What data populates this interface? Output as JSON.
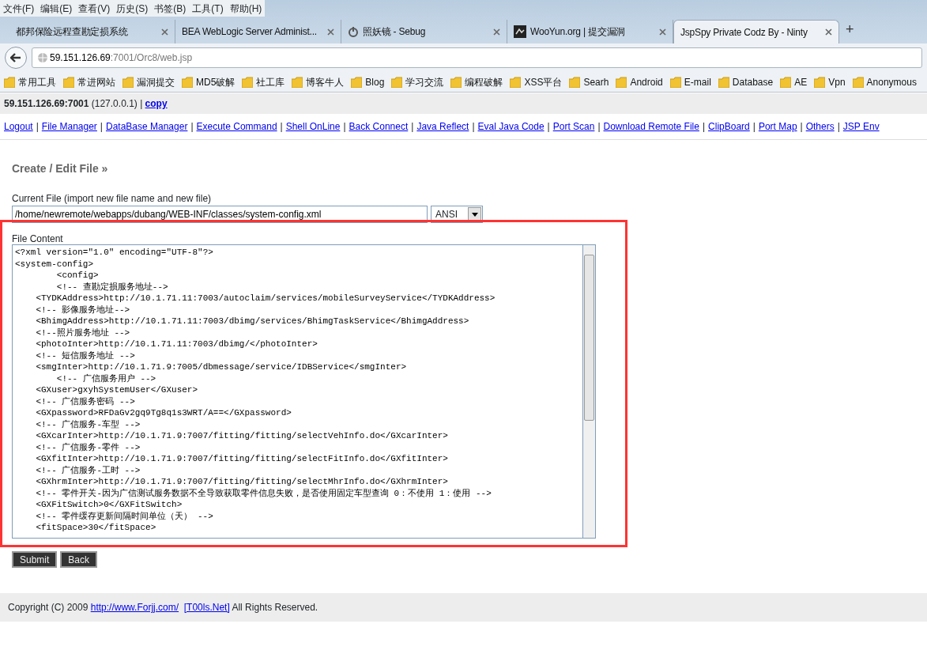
{
  "menu": [
    "文件(F)",
    "编辑(E)",
    "查看(V)",
    "历史(S)",
    "书签(B)",
    "工具(T)",
    "帮助(H)"
  ],
  "tabs": [
    {
      "label": "都邦保险远程查勘定损系统",
      "selected": false,
      "kind": "plain"
    },
    {
      "label": "BEA WebLogic Server Administ...",
      "selected": false,
      "kind": "plain"
    },
    {
      "label": "照妖镜 - Sebug",
      "selected": false,
      "kind": "ring"
    },
    {
      "label": "WooYun.org | 提交漏洞",
      "selected": false,
      "kind": "square"
    },
    {
      "label": "JspSpy Private Codz By - Ninty",
      "selected": true,
      "kind": "plain"
    }
  ],
  "new_tab": "+",
  "address": {
    "host": "59.151.126.69",
    "rest": ":7001/Orc8/web.jsp"
  },
  "bookmarks": [
    "常用工具",
    "常进网站",
    "漏洞提交",
    "MD5破解",
    "社工库",
    "博客牛人",
    "Blog",
    "学习交流",
    "编程破解",
    "XSS平台",
    "Searh",
    "Android",
    "E-mail",
    "Database",
    "AE",
    "Vpn",
    "Anonymous"
  ],
  "server": {
    "host": "59.151.126.69:7001",
    "ip": "(127.0.0.1)",
    "sep": "|",
    "copy": "copy"
  },
  "nav_separator": "|",
  "nav_links": [
    "Logout",
    "File Manager",
    "DataBase Manager",
    "Execute Command",
    "Shell OnLine",
    "Back Connect",
    "Java Reflect",
    "Eval Java Code",
    "Port Scan",
    "Download Remote File",
    "ClipBoard",
    "Port Map",
    "Others",
    "JSP Env"
  ],
  "heading": "Create / Edit File »",
  "current_file": {
    "label": "Current File (import new file name and new file)",
    "value": "/home/newremote/webapps/dubang/WEB-INF/classes/system-config.xml",
    "encoding": "ANSI"
  },
  "file_content": {
    "label": "File Content",
    "lines": [
      "<?xml version=\"1.0\" encoding=\"UTF-8\"?>",
      "<system-config>",
      "        <config>",
      "        <!-- 查勘定损服务地址-->",
      "    <TYDKAddress>http://10.1.71.11:7003/autoclaim/services/mobileSurveyService</TYDKAddress>",
      "    <!-- 影像服务地址-->",
      "    <BhimgAddress>http://10.1.71.11:7003/dbimg/services/BhimgTaskService</BhimgAddress>",
      "    <!--照片服务地址 -->",
      "    <photoInter>http://10.1.71.11:7003/dbimg/</photoInter>",
      "    <!-- 短信服务地址 -->",
      "    <smgInter>http://10.1.71.9:7005/dbmessage/service/IDBService</smgInter>",
      "        <!-- 广信服务用户 -->",
      "    <GXuser>gxyhSystemUser</GXuser>",
      "    <!-- 广信服务密码 -->",
      "    <GXpassword>RFDaGv2gq9Tg8q1s3WRT/A==</GXpassword>",
      "    <!-- 广信服务-车型 -->",
      "    <GXcarInter>http://10.1.71.9:7007/fitting/fitting/selectVehInfo.do</GXcarInter>",
      "    <!-- 广信服务-零件 -->",
      "    <GXfitInter>http://10.1.71.9:7007/fitting/fitting/selectFitInfo.do</GXfitInter>",
      "    <!-- 广信服务-工时 -->",
      "    <GXhrmInter>http://10.1.71.9:7007/fitting/fitting/selectMhrInfo.do</GXhrmInter>",
      "    <!-- 零件开关-因为广信测试服务数据不全导致获取零件信息失败，是否使用固定车型查询 0：不使用 1：使用 -->",
      "    <GXFitSwitch>0</GXFitSwitch>",
      "    <!-- 零件缓存更新间隔时间单位（天） -->",
      "    <fitSpace>30</fitSpace>"
    ]
  },
  "buttons": [
    "Submit",
    "Back"
  ],
  "footer": {
    "text": "Copyright (C) 2009",
    "link1": "http://www.Forjj.com/",
    "link2": "[T00ls.Net]",
    "tail": "All Rights Reserved."
  }
}
